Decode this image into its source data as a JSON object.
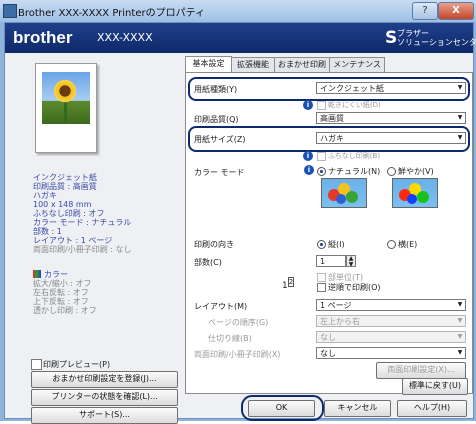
{
  "window": {
    "title": "Brother XXX-XXXX Printerのプロパティ",
    "help_btn": "?",
    "close_btn": "X"
  },
  "brand": {
    "logo": "brother",
    "model": "XXX-XXXX",
    "solutions_mark": "S",
    "solutions_line1": "ブラザー",
    "solutions_line2": "ソリューションセンター"
  },
  "tabs": [
    "基本設定",
    "拡張機能",
    "おまかせ印刷",
    "メンテナンス"
  ],
  "summary": {
    "lines": [
      "インクジェット紙",
      "印刷品質 : 高画質",
      "ハガキ",
      "100 x 148 mm",
      "ふちなし印刷 : オフ",
      "カラー モード : ナチュラル",
      "部数 : 1",
      "レイアウト : 1 ページ",
      "両面印刷/小冊子印刷 : なし"
    ],
    "color_head": "カラー",
    "color_lines": [
      "拡大/縮小 : オフ",
      "左右反転 : オフ",
      "上下反転 : オフ",
      "透かし印刷 : オフ"
    ]
  },
  "left": {
    "preview_label": "印刷プレビュー(P)",
    "btn_register": "おまかせ印刷設定を登録(J)...",
    "btn_status": "プリンターの状態を確認(L)...",
    "btn_support": "サポート(S)..."
  },
  "form": {
    "paper_type_label": "用紙種類(Y)",
    "paper_type_value": "インクジェット紙",
    "slow_dry_label": "乾きにくい紙(D)",
    "quality_label": "印刷品質(Q)",
    "quality_value": "高画質",
    "paper_size_label": "用紙サイズ(Z)",
    "paper_size_value": "ハガキ",
    "borderless_label": "ふちなし印刷(B)",
    "color_mode_label": "カラー モード",
    "natural_label": "ナチュラル(N)",
    "vivid_label": "鮮やか(V)",
    "orientation_label": "印刷の向き",
    "portrait_label": "縦(I)",
    "landscape_label": "横(E)",
    "copies_label": "部数(C)",
    "copies_value": "1",
    "collate_label": "部単位(T)",
    "reverse_label": "逆順で印刷(O)",
    "layout_label": "レイアウト(M)",
    "layout_value": "1 ページ",
    "page_order_label": "ページの順序(G)",
    "page_order_value": "左上から右",
    "border_label": "仕切り線(B)",
    "border_value": "なし",
    "duplex_label": "両面印刷/小冊子印刷(X)",
    "duplex_value": "なし",
    "duplex_settings_btn": "両面印刷設定(X)...",
    "default_btn": "標準に戻す(U)",
    "page_icon_1": "1",
    "page_icon_2": "2"
  },
  "footer": {
    "ok": "OK",
    "cancel": "キャンセル",
    "help": "ヘルプ(H)"
  },
  "colors": {
    "brand_bar": "#0f2a6a",
    "highlight": "#0e2a6e",
    "summary_text": "#3a4aa8"
  }
}
